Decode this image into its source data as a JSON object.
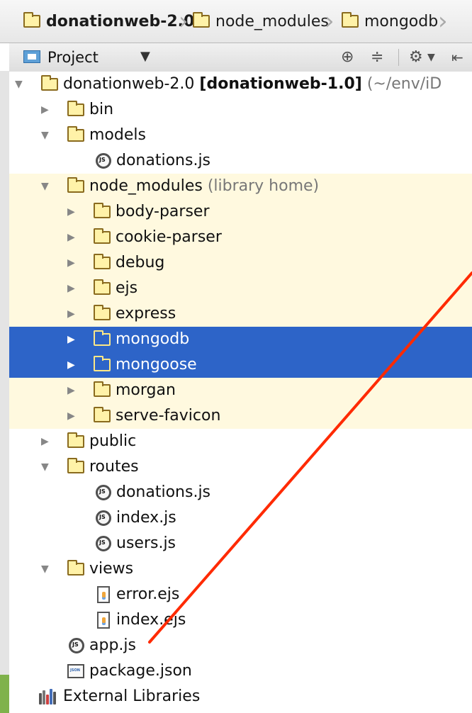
{
  "breadcrumb": [
    {
      "label": "donationweb-2.0"
    },
    {
      "label": "node_modules"
    },
    {
      "label": "mongodb"
    }
  ],
  "toolbar": {
    "project_label": "Project"
  },
  "tree": {
    "root": {
      "label": "donationweb-2.0",
      "module": "[donationweb-1.0]",
      "path": "(~/env/iD"
    },
    "bin": "bin",
    "models": "models",
    "models_donations": "donations.js",
    "node_modules": "node_modules",
    "node_modules_note": "(library home)",
    "body_parser": "body-parser",
    "cookie_parser": "cookie-parser",
    "debug": "debug",
    "ejs": "ejs",
    "express": "express",
    "mongodb": "mongodb",
    "mongoose": "mongoose",
    "morgan": "morgan",
    "serve_favicon": "serve-favicon",
    "public": "public",
    "routes": "routes",
    "routes_donations": "donations.js",
    "routes_index": "index.js",
    "routes_users": "users.js",
    "views": "views",
    "views_error": "error.ejs",
    "views_index": "index.ejs",
    "app_js": "app.js",
    "package_json": "package.json",
    "external_libraries": "External Libraries"
  },
  "colors": {
    "selected_background": "#2d64c8",
    "library_background": "#fff9df",
    "annotation_line": "#ff2a00"
  }
}
